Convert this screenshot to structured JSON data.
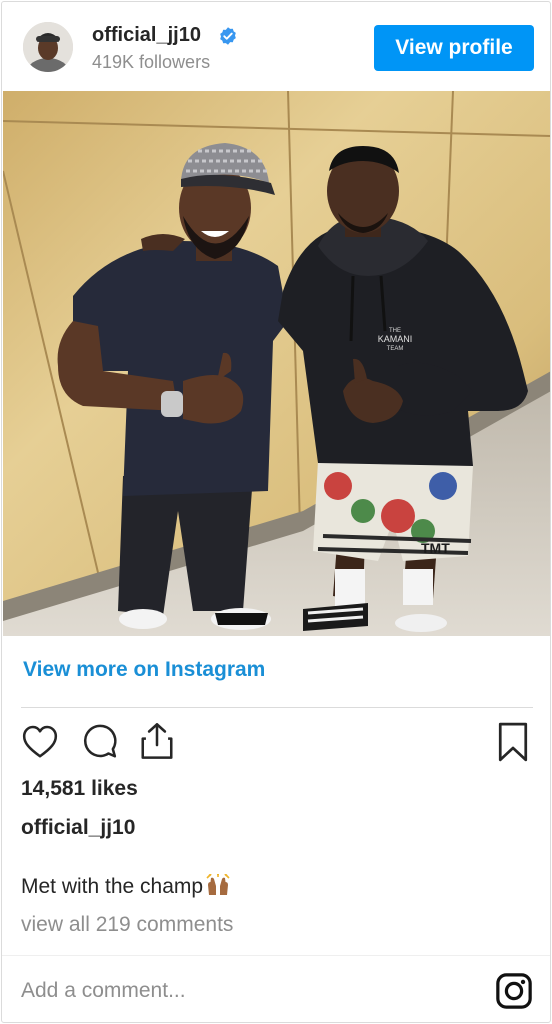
{
  "header": {
    "username": "official_jj10",
    "followers": "419K followers",
    "view_profile_label": "View profile"
  },
  "post": {
    "view_more_label": "View more on Instagram",
    "likes": "14,581 likes",
    "caption_user": "official_jj10",
    "caption_text": "Met with the champ",
    "view_comments_label": "view all 219 comments",
    "add_comment_placeholder": "Add a comment...",
    "photo_hoodie_text_line1": "THE",
    "photo_hoodie_text_line2": "KAMANI",
    "photo_hoodie_text_line3": "TEAM",
    "photo_shorts_text": "TMT"
  },
  "icons": {
    "verified": "verified-badge-icon",
    "heart": "heart-icon",
    "comment": "comment-icon",
    "share": "share-icon",
    "bookmark": "bookmark-icon",
    "instagram": "instagram-logo-icon",
    "emoji": "raising-hands-emoji"
  },
  "colors": {
    "primary_button": "#0095f6",
    "link_blue": "#1a8fd6",
    "verified_blue": "#3897f0",
    "text": "#262626",
    "muted": "#8e8e8e"
  }
}
